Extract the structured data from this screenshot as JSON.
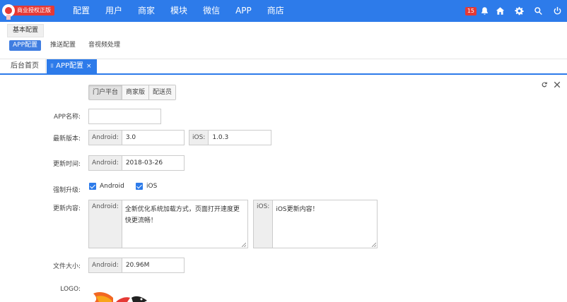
{
  "brand": {
    "label": "商业授权正版"
  },
  "nav": [
    "配置",
    "用户",
    "商家",
    "模块",
    "微信",
    "APP",
    "商店"
  ],
  "top_icons": {
    "notification_count": "15",
    "icons": [
      "bell-icon",
      "home-icon",
      "gear-icon",
      "search-icon",
      "power-icon"
    ]
  },
  "section_tab": "基本配置",
  "sub_tabs": [
    "APP配置",
    "推送配置",
    "音视频处理"
  ],
  "page_tabs": {
    "home": "后台首页",
    "active": "APP配置",
    "grip": "⠿",
    "close": "×"
  },
  "segments": [
    "门户平台",
    "商家版",
    "配送员"
  ],
  "form": {
    "app_name_label": "APP名称:",
    "app_name_value": "",
    "version_label": "最新版本:",
    "android_addon": "Android:",
    "ios_addon": "iOS:",
    "android_version": "3.0",
    "ios_version": "1.0.3",
    "update_time_label": "更新时间:",
    "update_time_value": "2018-03-26",
    "force_label": "强制升级:",
    "force_android": "Android",
    "force_ios": "iOS",
    "content_label": "更新内容:",
    "android_content": "全新优化系统加载方式，页面打开速度更快更流畅！",
    "ios_content": "iOS更新内容！",
    "size_label": "文件大小:",
    "size_value": "20.96M",
    "logo_label": "LOGO:"
  },
  "colors": {
    "primary": "#2d7bea",
    "badge": "#e53935"
  }
}
